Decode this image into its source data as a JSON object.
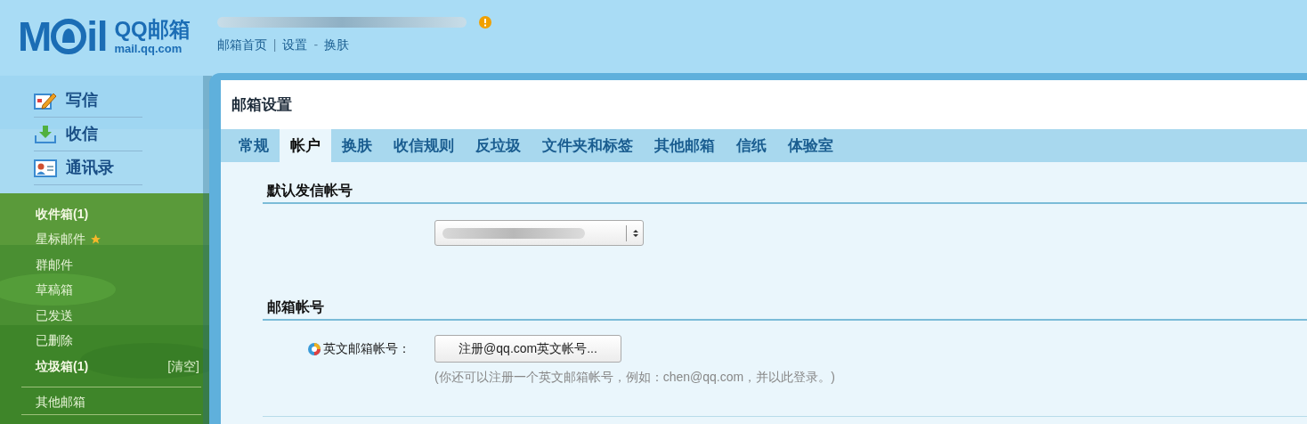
{
  "logo": {
    "mark_left": "M",
    "mark_right": "il",
    "brand": "QQ邮箱",
    "domain": "mail.qq.com"
  },
  "header": {
    "links": [
      {
        "kind": "link",
        "label": "邮箱首页"
      },
      {
        "kind": "separator",
        "label": "|"
      },
      {
        "kind": "link",
        "label": "设置"
      },
      {
        "kind": "separator",
        "label": "-"
      },
      {
        "kind": "link",
        "label": "换肤"
      }
    ],
    "alert": true
  },
  "sidebar": {
    "actions": [
      {
        "kind": "compose",
        "label": "写信"
      },
      {
        "kind": "inbox",
        "label": "收信"
      },
      {
        "kind": "contacts",
        "label": "通讯录"
      }
    ],
    "folders": [
      {
        "label": "收件箱(1)",
        "bold": true,
        "starred": false
      },
      {
        "label": "星标邮件",
        "bold": false,
        "starred": true
      },
      {
        "label": "群邮件",
        "bold": false,
        "starred": false
      },
      {
        "label": "草稿箱",
        "bold": false,
        "starred": false
      },
      {
        "label": "已发送",
        "bold": false,
        "starred": false
      },
      {
        "label": "已删除",
        "bold": false,
        "starred": false
      },
      {
        "label": "垃圾箱(1)",
        "bold": true,
        "starred": false,
        "action": "[清空]"
      }
    ],
    "other": "其他邮箱"
  },
  "main": {
    "title": "邮箱设置",
    "tabs": [
      {
        "label": "常规",
        "selected": false
      },
      {
        "label": "帐户",
        "selected": true
      },
      {
        "label": "换肤",
        "selected": false
      },
      {
        "label": "收信规则",
        "selected": false
      },
      {
        "label": "反垃圾",
        "selected": false
      },
      {
        "label": "文件夹和标签",
        "selected": false
      },
      {
        "label": "其他邮箱",
        "selected": false
      },
      {
        "label": "信纸",
        "selected": false
      },
      {
        "label": "体验室",
        "selected": false
      }
    ],
    "sections": [
      {
        "kind": "select",
        "heading": "默认发信帐号"
      },
      {
        "kind": "account",
        "heading": "邮箱帐号",
        "label": "英文邮箱帐号：",
        "button": "注册@qq.com英文帐号...",
        "hint": "(你还可以注册一个英文邮箱帐号，例如：chen@qq.com，并以此登录。)"
      }
    ]
  }
}
